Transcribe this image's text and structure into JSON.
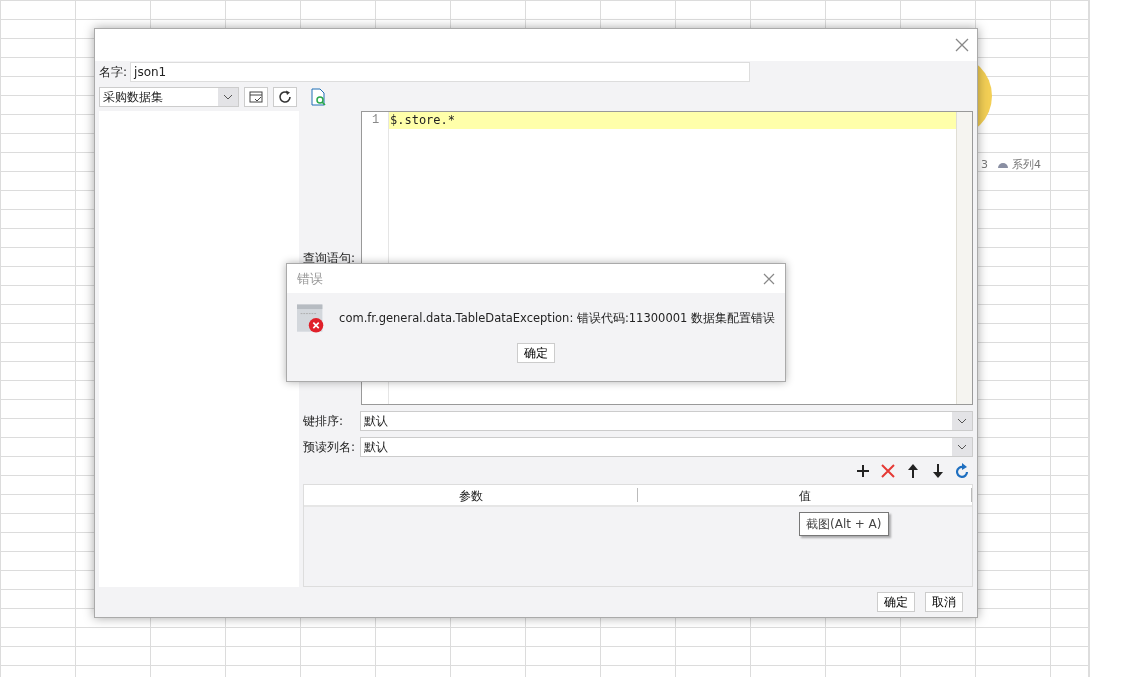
{
  "background": {
    "legend": [
      {
        "label": "3",
        "kind": "text"
      },
      {
        "label": "系列4",
        "kind": "cloud"
      }
    ]
  },
  "dialog": {
    "name_label": "名字:",
    "name_value": "json1",
    "dataset_select": "采购数据集",
    "query_label": "查询语句:",
    "editor": {
      "lines": [
        {
          "number": "1",
          "code": "$.store.*",
          "highlighted": true
        }
      ]
    },
    "fields": [
      {
        "label": "键排序:",
        "value": "默认"
      },
      {
        "label": "预读列名:",
        "value": "默认"
      }
    ],
    "toolbar": [
      {
        "kind": "add"
      },
      {
        "kind": "delete"
      },
      {
        "kind": "up"
      },
      {
        "kind": "down"
      },
      {
        "kind": "refresh"
      }
    ],
    "table": {
      "columns": [
        "参数",
        "值"
      ]
    },
    "tooltip": "截图(Alt + A)",
    "buttons": [
      "确定",
      "取消"
    ]
  },
  "error_dialog": {
    "title": "错误",
    "message": "com.fr.general.data.TableDataException: 错误代码:11300001 数据集配置错误",
    "button": "确定"
  }
}
